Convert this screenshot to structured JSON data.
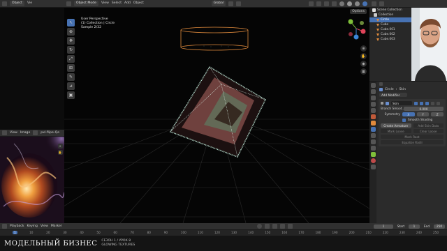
{
  "viewport_header": {
    "mode": "Object Mode",
    "menus": [
      "View",
      "Select",
      "Add",
      "Object"
    ],
    "transform": "Global",
    "options": "Options"
  },
  "left_header": {
    "mode": "Object",
    "view": "Vie"
  },
  "overlay": {
    "line1": "User Perspective",
    "line2": "(1) Collection | Circle",
    "line3": "Sample 2/32"
  },
  "image_editor": {
    "menus": [
      "View",
      "Image"
    ],
    "image_name": "pxl-flipe-Qe"
  },
  "outliner": {
    "title": "Scene Collection",
    "items": [
      "Collection",
      "Circle",
      "Cube",
      "Cube.001",
      "Cube.002",
      "Cube.003"
    ]
  },
  "properties": {
    "breadcrumb_object": "Circle",
    "breadcrumb_modifier": "Skin",
    "add_modifier": "Add Modifier",
    "modifier_name": "Skin",
    "branch_smooth_label": "Branch Smoot...",
    "branch_smooth_value": "0.000",
    "symmetry_label": "Symmetry",
    "axes": [
      "X",
      "Y",
      "Z"
    ],
    "smooth_shading": "Smooth Shading",
    "buttons": [
      "Create Armature",
      "Add Skin Data",
      "Mark Loose",
      "Clear Loose",
      "Mark Root",
      "Equalize Radii"
    ]
  },
  "timeline": {
    "menus": [
      "Playback",
      "Keying",
      "View",
      "Marker"
    ],
    "current_frame": "1",
    "start_label": "Start",
    "start_value": "1",
    "end_label": "End",
    "end_value": "250",
    "ticks": [
      "1",
      "10",
      "20",
      "30",
      "40",
      "50",
      "60",
      "70",
      "80",
      "90",
      "100",
      "110",
      "120",
      "130",
      "140",
      "150",
      "160",
      "170",
      "180",
      "190",
      "200",
      "210",
      "220",
      "230",
      "240",
      "250"
    ]
  },
  "branding": {
    "logo": "МОДЕЛЬНЫЙ БИЗНЕС",
    "line1": "СЕЗОН 1 / УРОК 8",
    "line2": "GLOWING TEXTURES"
  },
  "colors": {
    "accent": "#4772b3",
    "object_orange": "#e08a3c",
    "axis_x": "#e0445a",
    "axis_y": "#7fbf3a",
    "axis_z": "#3c86d8"
  }
}
